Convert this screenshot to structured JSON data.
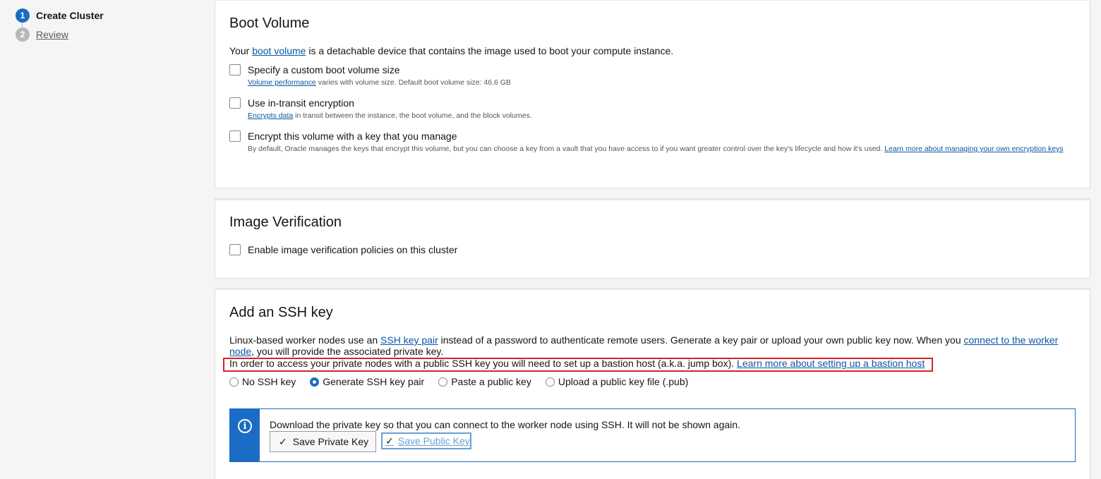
{
  "steps": [
    {
      "number": "1",
      "label": "Create Cluster"
    },
    {
      "number": "2",
      "label": "Review"
    }
  ],
  "boot_volume": {
    "title": "Boot Volume",
    "intro_prefix": "Your ",
    "intro_link": "boot volume",
    "intro_suffix": " is a detachable device that contains the image used to boot your compute instance.",
    "custom_size": {
      "label": "Specify a custom boot volume size",
      "help_link": "Volume performance",
      "help_text": " varies with volume size. Default boot volume size: 46.6 GB"
    },
    "in_transit": {
      "label": "Use in-transit encryption",
      "help_link": "Encrypts data",
      "help_text": " in transit between the instance, the boot volume, and the block volumes."
    },
    "own_key": {
      "label": "Encrypt this volume with a key that you manage",
      "help_text": "By default, Oracle manages the keys that encrypt this volume, but you can choose a key from a vault that you have access to if you want greater control over the key's lifecycle and how it's used. ",
      "help_link": "Learn more about managing your own encryption keys"
    }
  },
  "image_verification": {
    "title": "Image Verification",
    "checkbox_label": "Enable image verification policies on this cluster"
  },
  "ssh": {
    "title": "Add an SSH key",
    "desc_prefix": "Linux-based worker nodes use an ",
    "desc_link1": "SSH key pair",
    "desc_middle": " instead of a password to authenticate remote users. Generate a key pair or upload your own public key now. When you ",
    "desc_link2": "connect to the worker node",
    "desc_suffix": ", you will provide the associated private key.",
    "bastion_text": "In order to access your private nodes with a public SSH key you will need to set up a bastion host (a.k.a. jump box). ",
    "bastion_link": "Learn more about setting up a bastion host",
    "options": [
      "No SSH key",
      "Generate SSH key pair",
      "Paste a public key",
      "Upload a public key file (.pub)"
    ],
    "selected_option": "Generate SSH key pair",
    "info_text": "Download the private key so that you can connect to the worker node using SSH. It will not be shown again.",
    "save_private_label": "Save Private Key",
    "save_public_label": "Save Public Key"
  },
  "colors": {
    "accent": "#1a6cc4",
    "link": "#0b57a5",
    "highlight": "#d8232a"
  }
}
